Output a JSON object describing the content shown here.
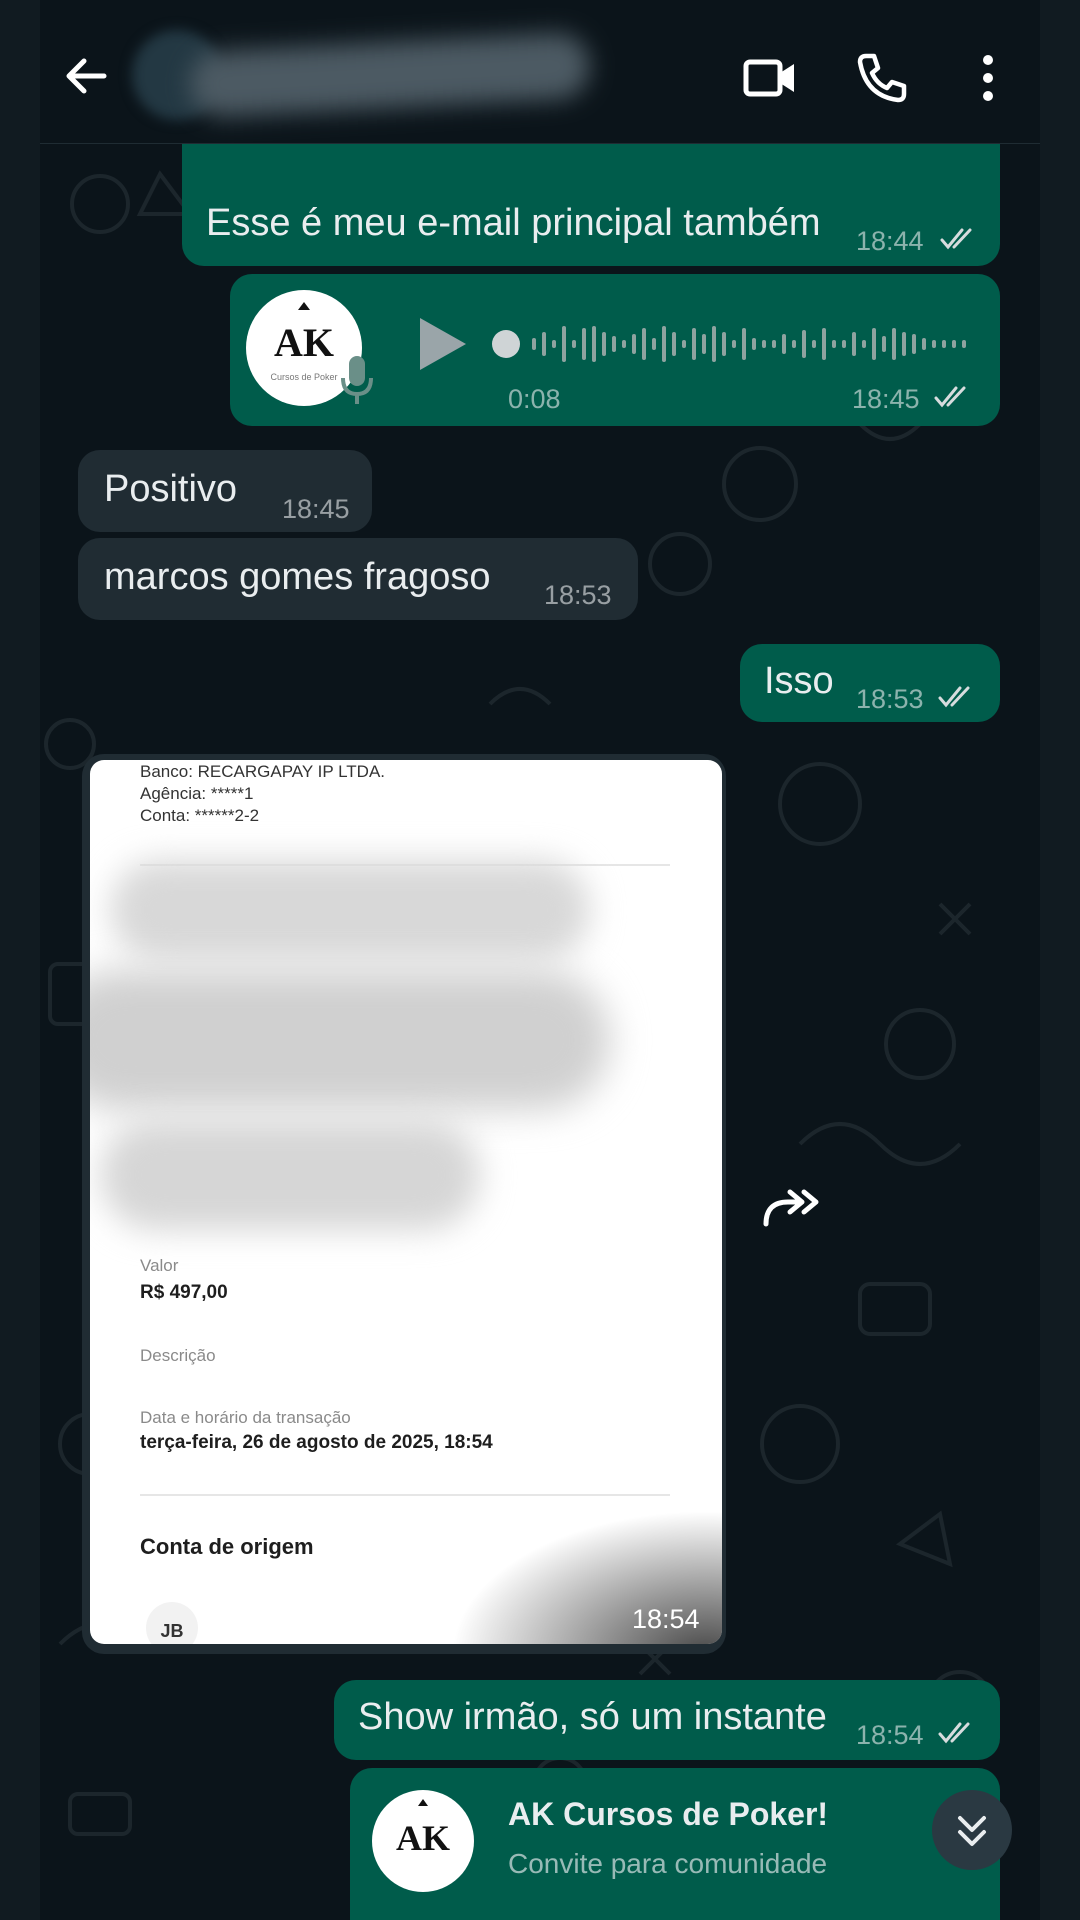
{
  "header": {
    "contact_name": "",
    "actions": [
      "video-call",
      "voice-call",
      "more-options"
    ]
  },
  "colors": {
    "background": "#0b141a",
    "outgoing_bubble": "#005c4b",
    "incoming_bubble": "#202c33",
    "link": "#53bdeb",
    "read_ticks": "#e9edef"
  },
  "messages": [
    {
      "direction": "out",
      "text": "Esse é meu e-mail principal também",
      "time": "18:44",
      "status": "read"
    },
    {
      "direction": "out",
      "type": "audio",
      "duration": "0:08",
      "time": "18:45",
      "status": "read"
    },
    {
      "direction": "in",
      "text": "Positivo",
      "time": "18:45"
    },
    {
      "direction": "in",
      "text": "marcos gomes fragoso",
      "time": "18:53"
    },
    {
      "direction": "out",
      "text": "Isso",
      "time": "18:53",
      "status": "read"
    },
    {
      "direction": "in",
      "type": "image",
      "time": "18:54"
    },
    {
      "direction": "out",
      "text": "Show irmão, só um instante",
      "time": "18:54",
      "status": "read"
    }
  ],
  "audio_avatar": {
    "initials": "AK",
    "caption": "Cursos de Poker"
  },
  "receipt": {
    "bank_line": "Banco: RECARGAPAY IP LTDA.",
    "agency_line": "Agência: *****1",
    "account_line": "Conta: ******2-2",
    "value_label": "Valor",
    "value": "R$ 497,00",
    "description_label": "Descrição",
    "datetime_label": "Data e horário da transação",
    "datetime": "terça-feira, 26 de agosto de 2025, 18:54",
    "origin_heading": "Conta de origem",
    "origin_initials": "JB"
  },
  "invite": {
    "initials": "AK",
    "title": "AK Cursos de Poker!",
    "subtitle": "Convite para comunidade"
  }
}
